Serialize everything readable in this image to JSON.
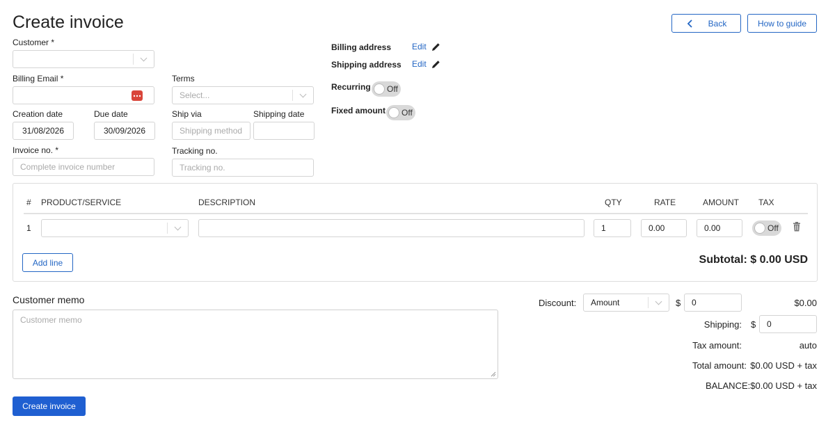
{
  "header": {
    "title": "Create invoice",
    "back_label": "Back",
    "guide_label": "How to guide"
  },
  "form": {
    "customer_label": "Customer *",
    "customer_value": "",
    "billing_email_label": "Billing Email *",
    "billing_email_value": "",
    "terms_label": "Terms",
    "terms_placeholder": "Select...",
    "creation_date_label": "Creation date",
    "creation_date_value": "31/08/2026",
    "due_date_label": "Due date",
    "due_date_value": "30/09/2026",
    "ship_via_label": "Ship via",
    "ship_via_placeholder": "Shipping method",
    "shipping_date_label": "Shipping date",
    "shipping_date_value": "",
    "invoice_no_label": "Invoice no. *",
    "invoice_no_placeholder": "Complete invoice number",
    "tracking_no_label": "Tracking no.",
    "tracking_no_placeholder": "Tracking no."
  },
  "side": {
    "billing_address_label": "Billing address",
    "shipping_address_label": "Shipping address",
    "edit_label": "Edit",
    "recurring_label": "Recurring",
    "recurring_state": "Off",
    "fixed_amount_label": "Fixed amount",
    "fixed_amount_state": "Off"
  },
  "table": {
    "columns": {
      "num": "#",
      "product": "PRODUCT/SERVICE",
      "description": "DESCRIPTION",
      "qty": "QTY",
      "rate": "RATE",
      "amount": "AMOUNT",
      "tax": "TAX"
    },
    "rows": [
      {
        "num": "1",
        "product": "",
        "description": "",
        "qty": "1",
        "rate": "0.00",
        "amount": "0.00",
        "tax": "Off"
      }
    ],
    "add_line_label": "Add line",
    "subtotal": "Subtotal: $ 0.00 USD"
  },
  "memo": {
    "title": "Customer memo",
    "placeholder": "Customer memo"
  },
  "summary": {
    "discount_label": "Discount:",
    "discount_type": "Amount",
    "currency_symbol": "$",
    "discount_value": "0",
    "discount_total": "$0.00",
    "shipping_label": "Shipping:",
    "shipping_value": "0",
    "tax_amount_label": "Tax amount:",
    "tax_amount_value": "auto",
    "total_amount_label": "Total amount:",
    "total_amount_value": "$0.00 USD + tax",
    "balance_label": "BALANCE:",
    "balance_value": "$0.00 USD + tax"
  },
  "footer": {
    "create_label": "Create invoice"
  },
  "colors": {
    "accent": "#2366c4",
    "primary_button": "#1f5fd1",
    "email_badge": "#d9453a"
  }
}
